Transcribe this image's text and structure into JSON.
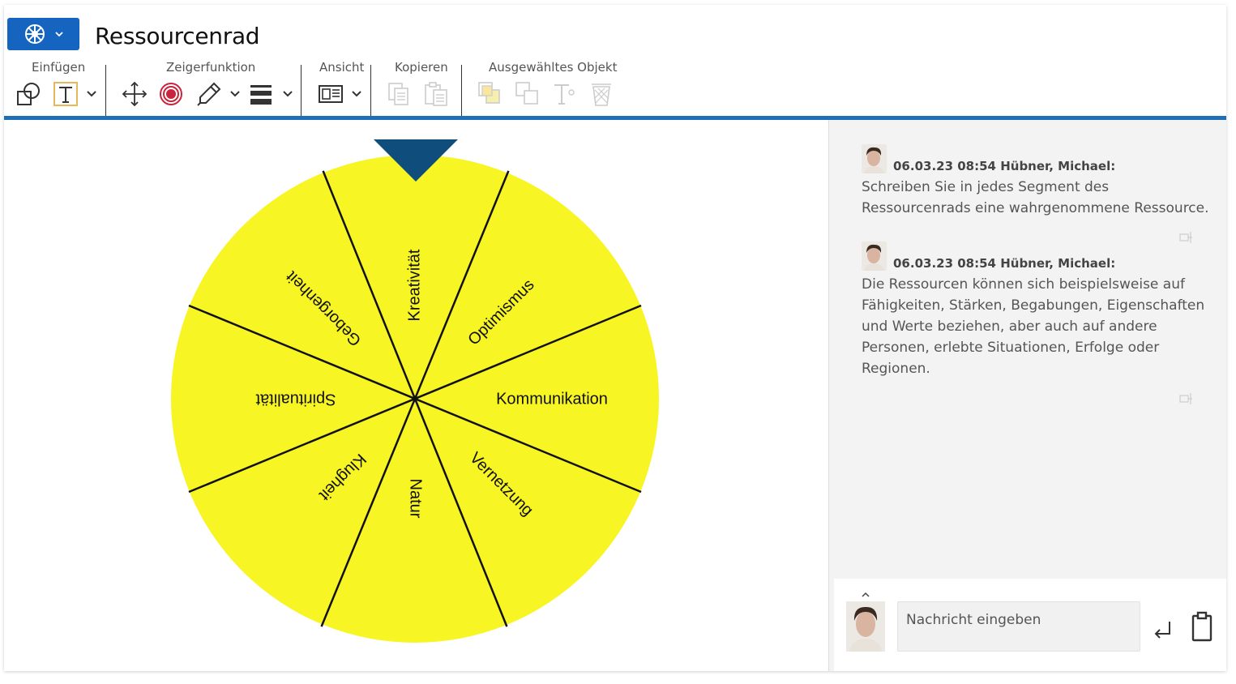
{
  "app": {
    "title": "Ressourcenrad",
    "app_icon": "wheel-icon"
  },
  "toolbar": {
    "groups": [
      {
        "label": "Einfügen",
        "tools": [
          "shape-icon",
          "text-icon"
        ]
      },
      {
        "label": "Zeigerfunktion",
        "tools": [
          "move-icon",
          "target-icon",
          "pen-icon",
          "line-weight-icon"
        ]
      },
      {
        "label": "Ansicht",
        "tools": [
          "view-icon"
        ]
      },
      {
        "label": "Kopieren",
        "tools": [
          "copy-icon",
          "paste-icon"
        ]
      },
      {
        "label": "Ausgewähltes Objekt",
        "tools": [
          "bring-front-icon",
          "send-back-icon",
          "text-format-icon",
          "delete-icon"
        ]
      }
    ]
  },
  "wheel": {
    "fill": "#f7f523",
    "pointer_color": "#0e4d7c",
    "segments": [
      "Kreativität",
      "Optimismus",
      "Kommunikation",
      "Vernetzung",
      "Natur",
      "Klugheit",
      "Spiritualität",
      "Geborgenheit"
    ]
  },
  "chat": {
    "messages": [
      {
        "header": "06.03.23 08:54 Hübner, Michael:",
        "text": "Schreiben Sie in jedes Segment des Ressourcenrads eine wahrgenommene Ressource."
      },
      {
        "header": "06.03.23 08:54 Hübner, Michael:",
        "text": "Die Ressourcen können sich beispielsweise auf Fähigkeiten, Stärken, Begabungen, Eigenschaften und Werte beziehen, aber auch auf andere Personen, erlebte Situationen, Erfolge oder Regionen."
      }
    ],
    "input_placeholder": "Nachricht eingeben"
  },
  "colors": {
    "accent": "#1565c0",
    "divider": "#1f6fb5"
  }
}
